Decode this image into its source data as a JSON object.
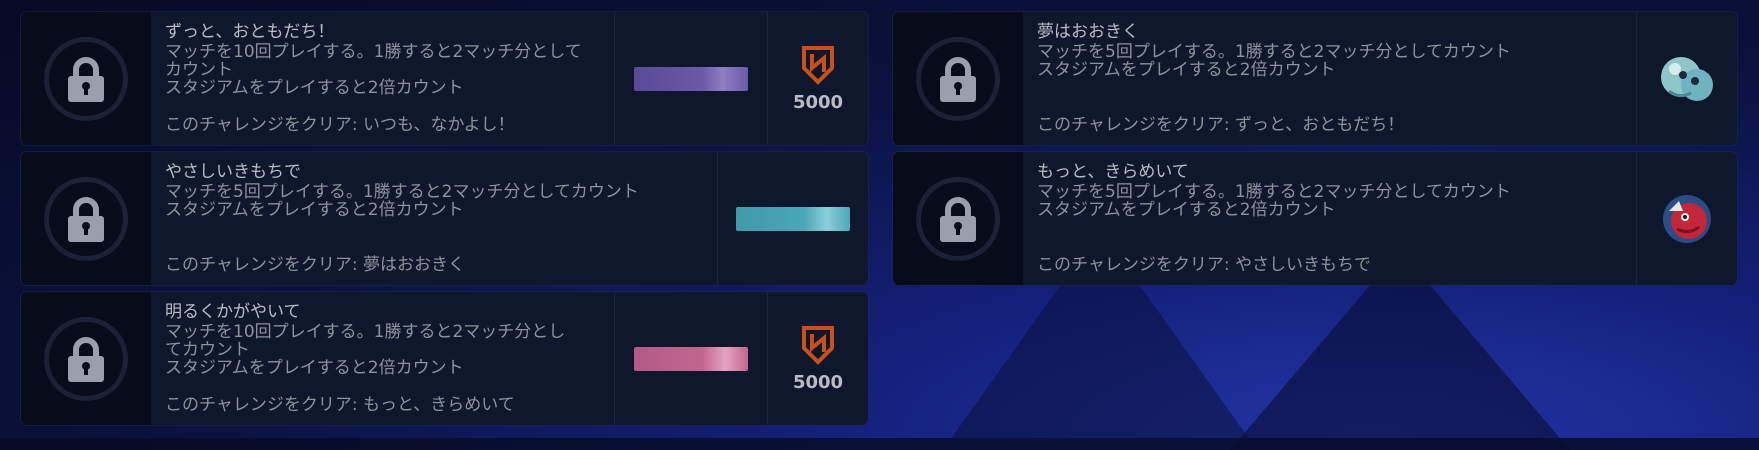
{
  "challenges": [
    {
      "title": "ずっと、おともだち！",
      "desc": [
        "マッチを10回プレイする。1勝すると2マッチ分として",
        "カウント",
        "スタジアムをプレイすると2倍カウント"
      ],
      "clear": "このチャレンジをクリア: いつも、なかよし！",
      "banner_color": "#6a5aa8",
      "currency": "5000"
    },
    {
      "title": "やさしいきもちで",
      "desc": [
        "マッチを5回プレイする。1勝すると2マッチ分としてカウント",
        "スタジアムをプレイすると2倍カウント"
      ],
      "clear": "このチャレンジをクリア: 夢はおおきく",
      "banner_color": "#4aa7b8"
    },
    {
      "title": "明るくかがやいて",
      "desc": [
        "マッチを10回プレイする。1勝すると2マッチ分とし",
        "てカウント",
        "スタジアムをプレイすると2倍カウント"
      ],
      "clear": "このチャレンジをクリア: もっと、きらめいて",
      "banner_color": "#c2668f",
      "currency": "5000"
    },
    {
      "title": "夢はおおきく",
      "desc": [
        "マッチを5回プレイする。1勝すると2マッチ分としてカウント",
        "スタジアムをプレイすると2倍カウント"
      ],
      "clear": "このチャレンジをクリア: ずっと、おともだち！",
      "sticker": "blue-creature-sticker"
    },
    {
      "title": "もっと、きらめいて",
      "desc": [
        "マッチを5回プレイする。1勝すると2マッチ分としてカウント",
        "スタジアムをプレイすると2倍カウント"
      ],
      "clear": "このチャレンジをクリア: やさしいきもちで",
      "sticker": "red-creature-sticker"
    }
  ],
  "icons": {
    "lock": "lock-icon",
    "currency": "shield-currency-icon",
    "currency_color": "#c8501a"
  }
}
